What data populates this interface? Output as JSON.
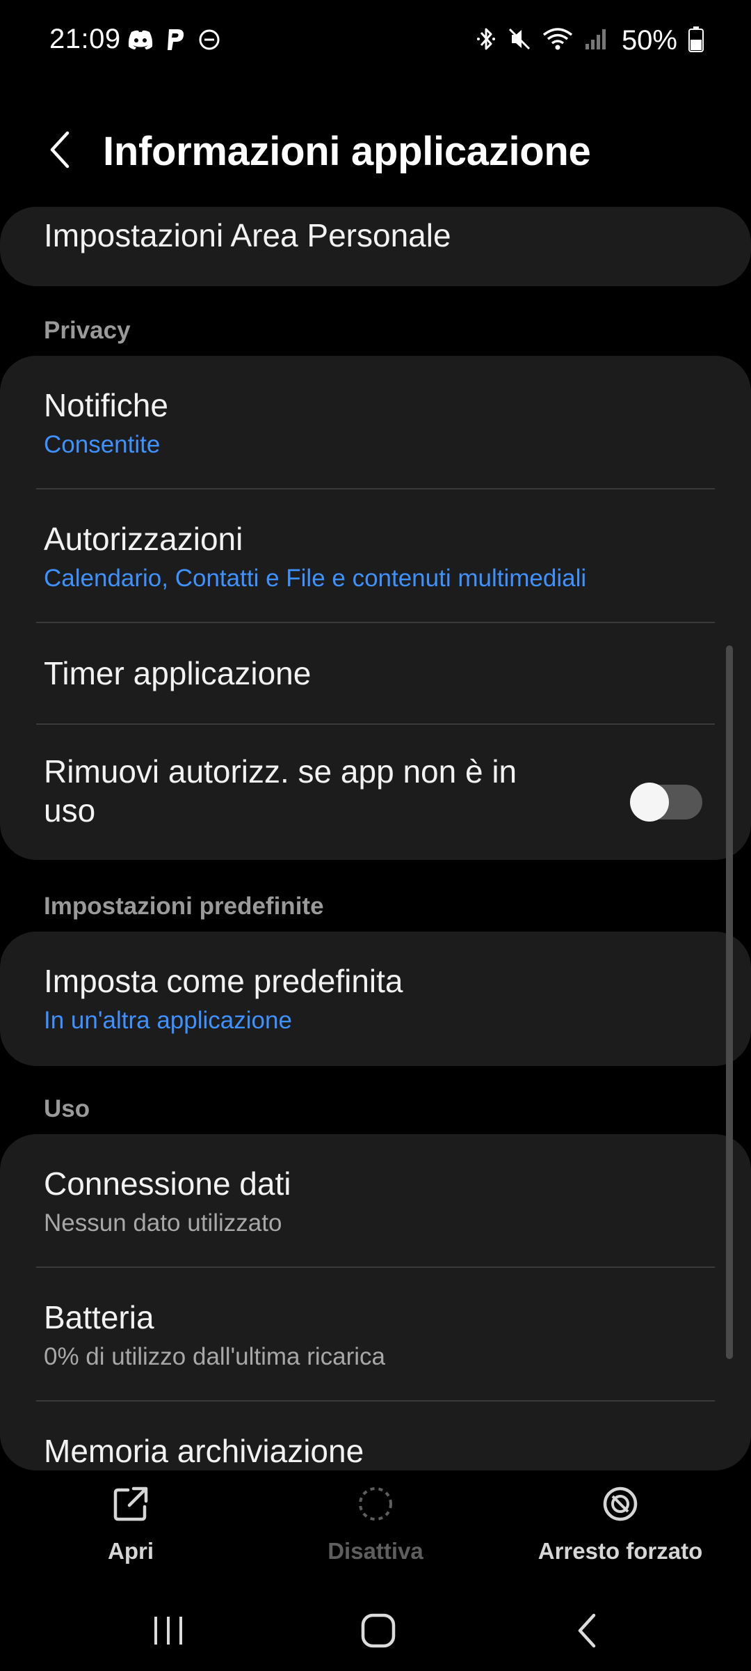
{
  "status_bar": {
    "time": "21:09",
    "left_icons": [
      "discord-icon",
      "paypal-icon",
      "do-not-disturb-icon"
    ],
    "right_icons": [
      "bluetooth-icon",
      "mute-icon",
      "wifi-icon",
      "signal-icon"
    ],
    "battery_percent": "50%"
  },
  "header": {
    "title": "Informazioni applicazione"
  },
  "content": {
    "top_item": {
      "title": "Impostazioni Area Personale"
    },
    "privacy": {
      "label": "Privacy",
      "items": [
        {
          "title": "Notifiche",
          "subtitle": "Consentite"
        },
        {
          "title": "Autorizzazioni",
          "subtitle": "Calendario, Contatti e File e contenuti multimediali"
        },
        {
          "title": "Timer applicazione"
        },
        {
          "title_line1": "Rimuovi autorizz. se app non è in",
          "title_line2": "uso",
          "toggle_on": false
        }
      ]
    },
    "defaults": {
      "label": "Impostazioni predefinite",
      "items": [
        {
          "title": "Imposta come predefinita",
          "subtitle": "In un'altra applicazione"
        }
      ]
    },
    "usage": {
      "label": "Uso",
      "items": [
        {
          "title": "Connessione dati",
          "subtitle": "Nessun dato utilizzato"
        },
        {
          "title": "Batteria",
          "subtitle": "0% di utilizzo dall'ultima ricarica"
        },
        {
          "title": "Memoria archiviazione"
        }
      ]
    }
  },
  "actions": {
    "open": {
      "label": "Apri",
      "icon": "open-external-icon",
      "enabled": true
    },
    "disable": {
      "label": "Disattiva",
      "icon": "disable-icon",
      "enabled": false
    },
    "force_stop": {
      "label": "Arresto forzato",
      "icon": "force-stop-icon",
      "enabled": true
    }
  },
  "navigation": {
    "buttons": [
      "recents-icon",
      "home-icon",
      "back-icon"
    ]
  },
  "colors": {
    "background": "#000000",
    "card": "#1c1c1c",
    "accent_blue": "#3e91ff",
    "text_primary": "#f2f2f2",
    "text_secondary": "#a8a8a8",
    "disabled": "#6a6a6a"
  }
}
